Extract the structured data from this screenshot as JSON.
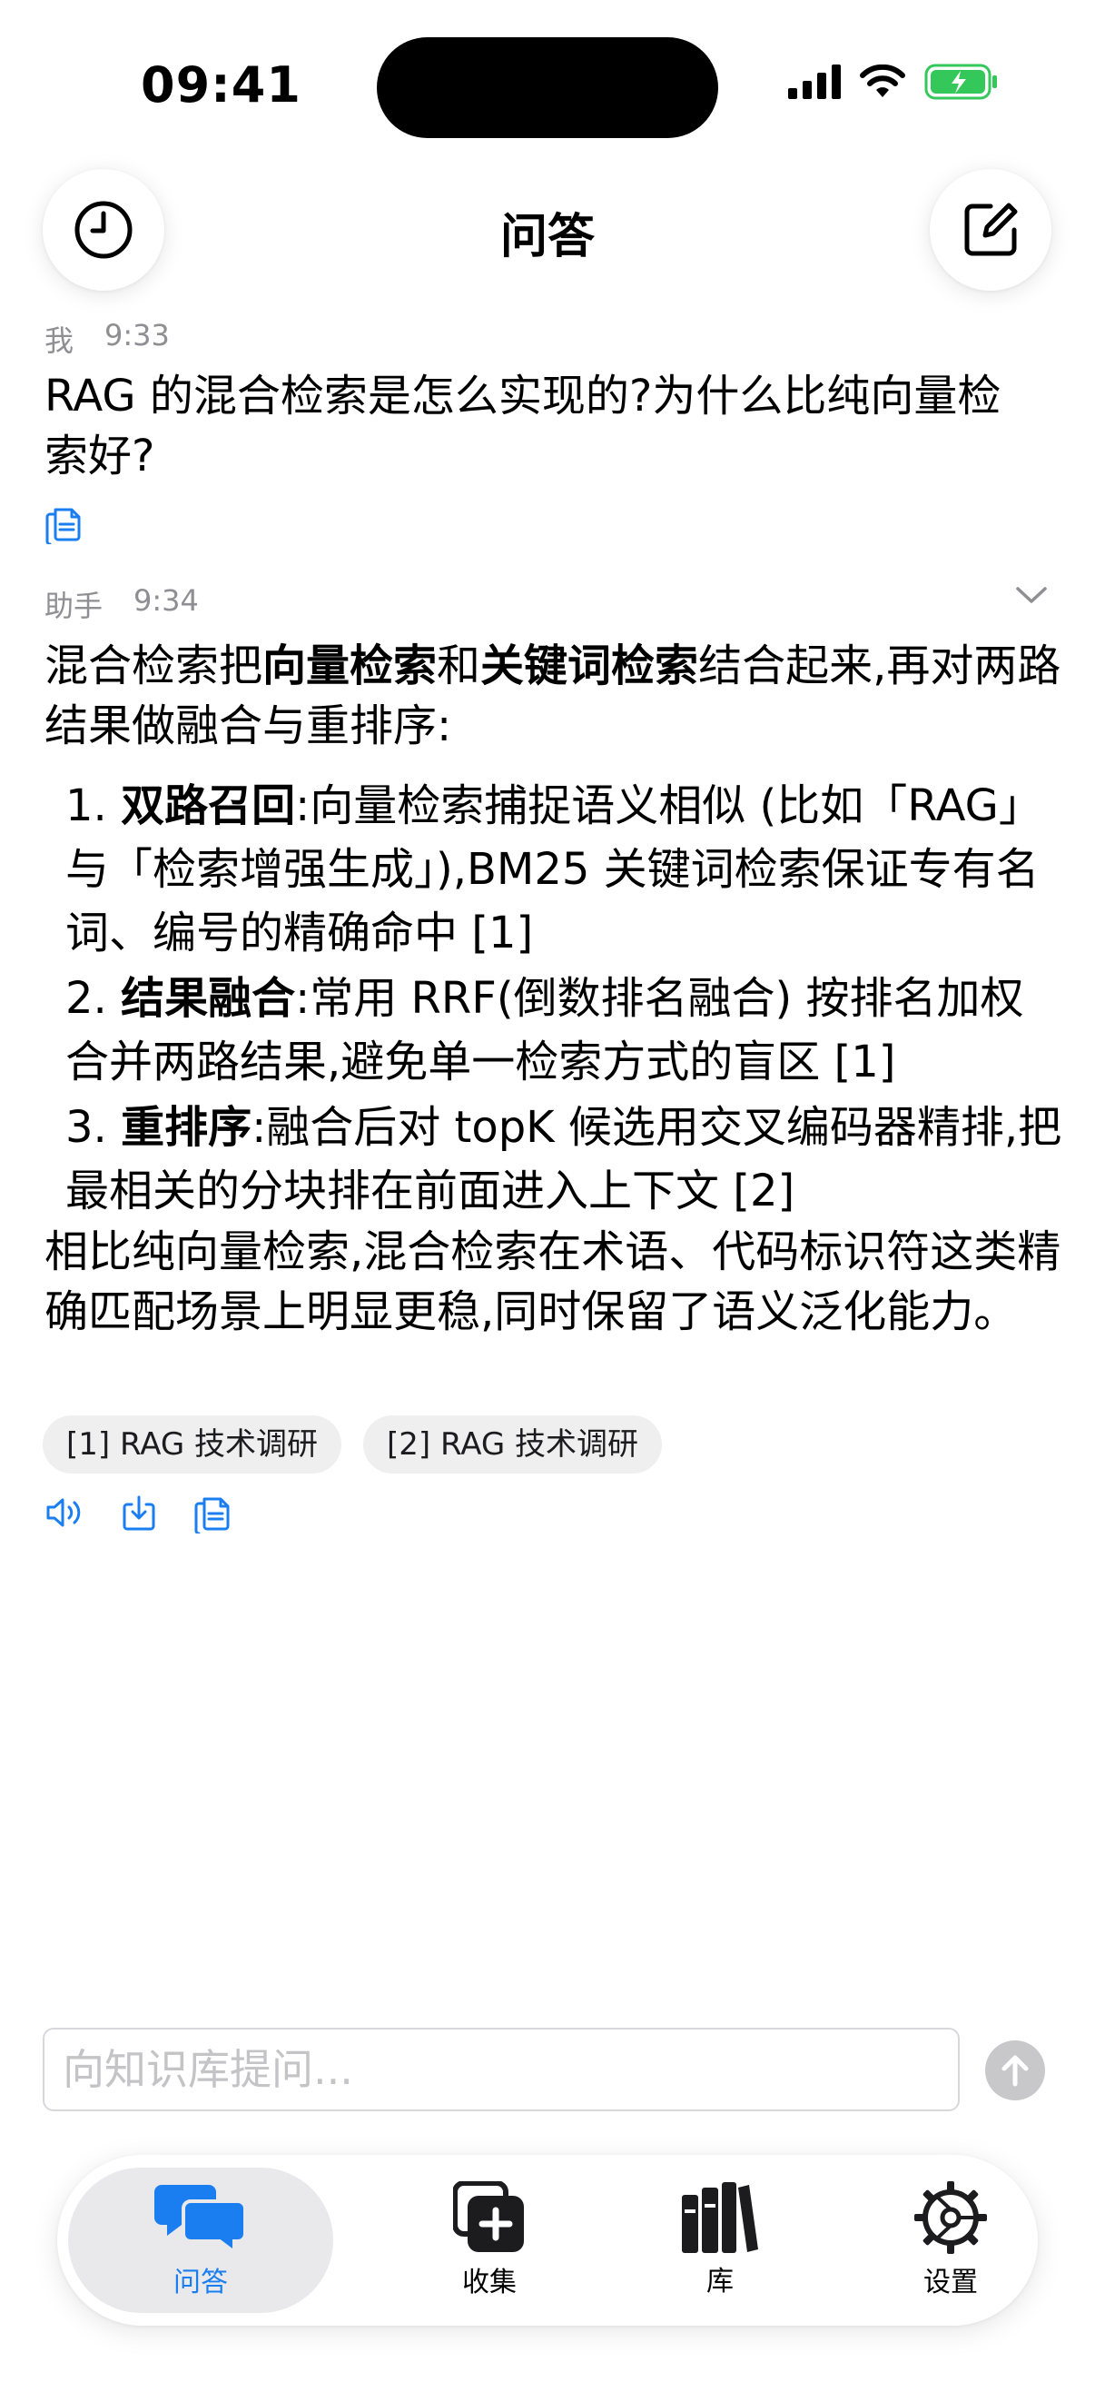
{
  "status_bar": {
    "time": "09:41"
  },
  "header": {
    "title": "问答"
  },
  "user_message": {
    "sender": "我",
    "time": "9:33",
    "text": "RAG 的混合检索是怎么实现的?为什么比纯向量检索好?"
  },
  "assistant_message": {
    "sender": "助手",
    "time": "9:34",
    "intro": {
      "p1": "混合检索把",
      "b1": "向量检索",
      "p2": "和",
      "b2": "关键词检索",
      "p3": "结合起来,再对两路结果做融合与重排序:"
    },
    "items": [
      {
        "num": "1.",
        "title": "双路召回",
        "text": ":向量检索捕捉语义相似 (比如「RAG」与「检索增强生成」),BM25 关键词检索保证专有名词、编号的精确命中 [1]"
      },
      {
        "num": "2.",
        "title": "结果融合",
        "text": ":常用 RRF(倒数排名融合) 按排名加权合并两路结果,避免单一检索方式的盲区 [1]"
      },
      {
        "num": "3.",
        "title": "重排序",
        "text": ":融合后对 topK 候选用交叉编码器精排,把最相关的分块排在前面进入上下文 [2]"
      }
    ],
    "closing": "相比纯向量检索,混合检索在术语、代码标识符这类精确匹配场景上明显更稳,同时保留了语义泛化能力。",
    "citations": [
      "[1] RAG 技术调研",
      "[2] RAG 技术调研"
    ]
  },
  "composer": {
    "placeholder": "向知识库提问..."
  },
  "tabs": [
    {
      "label": "问答",
      "icon": "chat-bubbles-icon",
      "active": true
    },
    {
      "label": "收集",
      "icon": "add-collection-icon",
      "active": false
    },
    {
      "label": "库",
      "icon": "library-books-icon",
      "active": false
    },
    {
      "label": "设置",
      "icon": "gear-icon",
      "active": false
    }
  ],
  "colors": {
    "accent": "#1a7ef0",
    "muted": "#8e8e93",
    "chip": "#efefef",
    "battery": "#34c759"
  }
}
